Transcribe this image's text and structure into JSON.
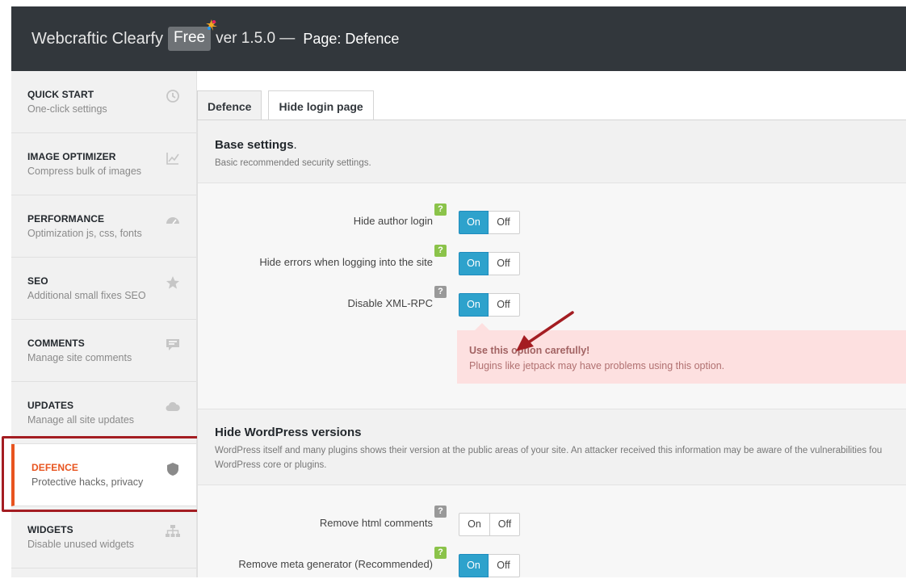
{
  "header": {
    "brand": "Webcraftic Clearfy",
    "badge": "Free",
    "version": "ver 1.5.0 —",
    "page_title": "Page: Defence"
  },
  "sidebar": {
    "items": [
      {
        "title": "QUICK START",
        "sub": "One-click settings",
        "icon": "clock-icon"
      },
      {
        "title": "IMAGE OPTIMIZER",
        "sub": "Compress bulk of images",
        "icon": "chart-icon"
      },
      {
        "title": "PERFORMANCE",
        "sub": "Optimization js, css, fonts",
        "icon": "dashboard-icon"
      },
      {
        "title": "SEO",
        "sub": "Additional small fixes SEO",
        "icon": "star-icon"
      },
      {
        "title": "COMMENTS",
        "sub": "Manage site comments",
        "icon": "comment-icon"
      },
      {
        "title": "UPDATES",
        "sub": "Manage all site updates",
        "icon": "cloud-icon"
      },
      {
        "title": "DEFENCE",
        "sub": "Protective hacks, privacy",
        "icon": "shield-icon",
        "active": true
      },
      {
        "title": "WIDGETS",
        "sub": "Disable unused widgets",
        "icon": "sitemap-icon"
      }
    ]
  },
  "tabs": [
    {
      "label": "Defence",
      "active": true
    },
    {
      "label": "Hide login page",
      "active": false
    }
  ],
  "sections": {
    "base": {
      "title": "Base settings",
      "title_suffix": ".",
      "desc": "Basic recommended security settings."
    },
    "versions": {
      "title": "Hide WordPress versions",
      "desc": "WordPress itself and many plugins shows their version at the public areas of your site. An attacker received this information may be aware of the vulnerabilities fou WordPress core or plugins."
    }
  },
  "toggles": {
    "on_label": "On",
    "off_label": "Off",
    "rows": [
      {
        "label": "Hide author login",
        "help": "?",
        "help_color": "green",
        "value": "On"
      },
      {
        "label": "Hide errors when logging into the site",
        "help": "?",
        "help_color": "green",
        "value": "On"
      },
      {
        "label": "Disable XML-RPC",
        "help": "?",
        "help_color": "gray",
        "value": "On"
      },
      {
        "label": "Remove html comments",
        "help": "?",
        "help_color": "gray",
        "value": "Off"
      },
      {
        "label": "Remove meta generator (Recommended)",
        "help": "?",
        "help_color": "green",
        "value": "On"
      }
    ]
  },
  "warning": {
    "title": "Use this option carefully!",
    "text": "Plugins like jetpack may have problems using this option."
  },
  "colors": {
    "header_bg": "#32373c",
    "accent_orange": "#e8541f",
    "toggle_on": "#2ea2cc",
    "highlight_red": "#a41d22",
    "warn_bg": "#fde0e0"
  }
}
